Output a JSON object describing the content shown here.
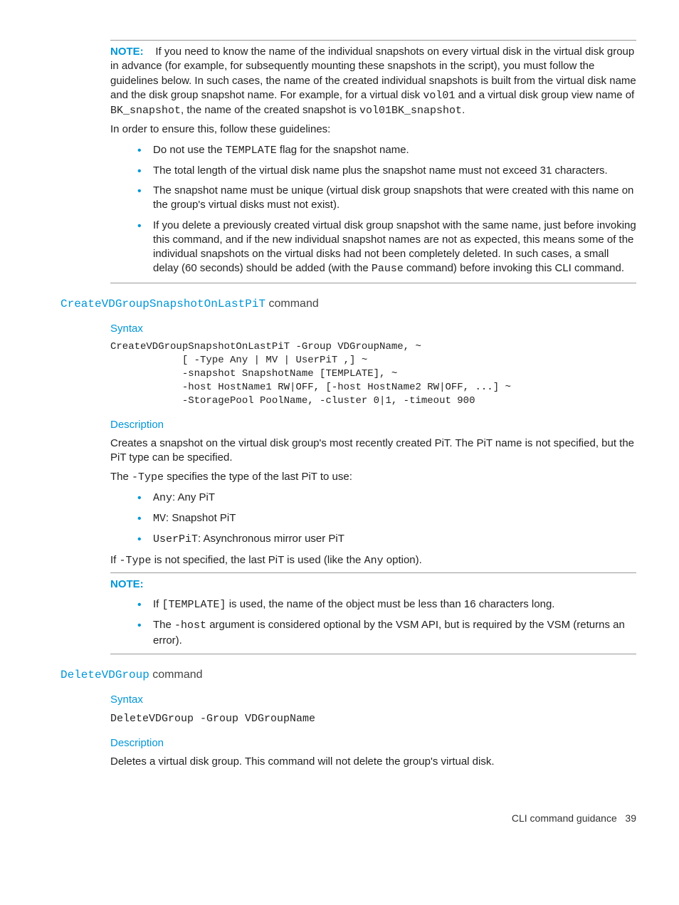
{
  "note1": {
    "label": "NOTE:",
    "para_pre": "If you need to know the name of the individual snapshots on every virtual disk in the virtual disk group in advance (for example, for subsequently mounting these snapshots in the script), you must follow the guidelines below. In such cases, the name of the created individual snapshots is built from the virtual disk name and the disk group snapshot name. For example, for a virtual disk ",
    "code1": "vol01",
    "mid1": " and a virtual disk group view name of ",
    "code2": "BK_snapshot",
    "mid2": ", the name of the created snapshot is ",
    "code3": "vol01BK_snapshot",
    "end": ".",
    "follow": "In order to ensure this, follow these guidelines:",
    "b1_pre": "Do not use the ",
    "b1_code": "TEMPLATE",
    "b1_post": " flag for the snapshot name.",
    "b2": "The total length of the virtual disk name plus the snapshot name must not exceed 31 characters.",
    "b3": "The snapshot name must be unique (virtual disk group snapshots that were created with this name on the group's virtual disks must not exist).",
    "b4_pre": "If you delete a previously created virtual disk group snapshot with the same name, just before invoking this command, and if the new individual snapshot names are not as expected, this means some of the individual snapshots on the virtual disks had not been completely deleted. In such cases, a small delay (60 seconds) should be added (with the ",
    "b4_code": "Pause",
    "b4_post": " command) before invoking this CLI command."
  },
  "sec1": {
    "cmd": "CreateVDGroupSnapshotOnLastPiT",
    "suffix": " command",
    "syntax_label": "Syntax",
    "syntax": "CreateVDGroupSnapshotOnLastPiT -Group VDGroupName, ~\n            [ -Type Any | MV | UserPiT ,] ~\n            -snapshot SnapshotName [TEMPLATE], ~\n            -host HostName1 RW|OFF, [-host HostName2 RW|OFF, ...] ~\n            -StoragePool PoolName, -cluster 0|1, -timeout 900",
    "desc_label": "Description",
    "desc1": "Creates a snapshot on the virtual disk group's most recently created PiT. The PiT name is not specified, but the PiT type can be specified.",
    "desc2_pre": "The ",
    "desc2_code": "-Type",
    "desc2_post": " specifies the type of the last PiT to use:",
    "t_any_code": "Any",
    "t_any": ": Any PiT",
    "t_mv_code": "MV",
    "t_mv": ": Snapshot PiT",
    "t_up_code": "UserPiT",
    "t_up": ": Asynchronous mirror user PiT",
    "desc3_pre": "If ",
    "desc3_code": "-Type",
    "desc3_mid": " is not specified, the last PiT is used (like the ",
    "desc3_code2": "Any",
    "desc3_post": " option)."
  },
  "note2": {
    "label": "NOTE:",
    "b1_pre": "If ",
    "b1_code": "[TEMPLATE]",
    "b1_post": " is used, the name of the object must be less than 16 characters long.",
    "b2_pre": "The ",
    "b2_code": "-host",
    "b2_post": " argument is considered optional by the VSM API, but is required by the VSM (returns an error)."
  },
  "sec2": {
    "cmd": "DeleteVDGroup",
    "suffix": " command",
    "syntax_label": "Syntax",
    "syntax": "DeleteVDGroup -Group VDGroupName",
    "desc_label": "Description",
    "desc": "Deletes a virtual disk group. This command will not delete the group's virtual disk."
  },
  "footer": {
    "text": "CLI command guidance",
    "page": "39"
  }
}
